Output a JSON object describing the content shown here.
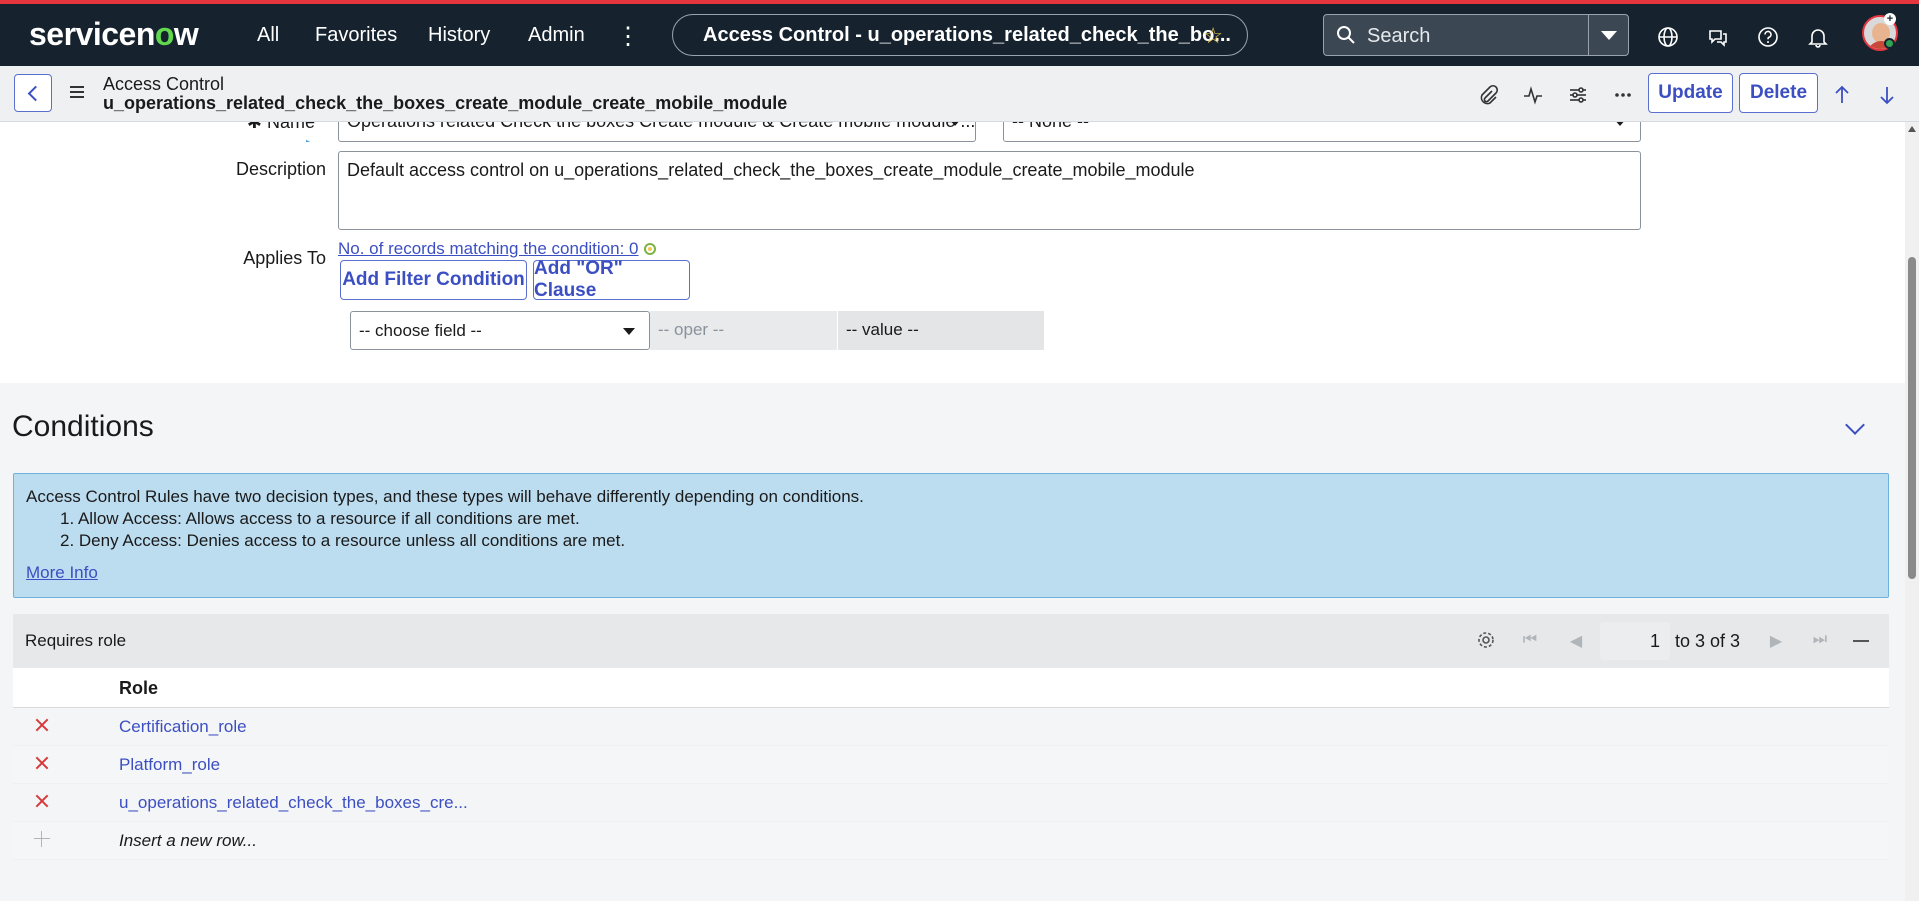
{
  "nav": {
    "logo_pre": "servicen",
    "logo_o": "o",
    "logo_post": "w",
    "links": [
      "All",
      "Favorites",
      "History",
      "Admin"
    ],
    "more": "⋮",
    "page_title": "Access Control - u_operations_related_check_the_bo...",
    "star": "☆",
    "search_placeholder": "Search"
  },
  "form_header": {
    "title": "Access Control",
    "subtitle": "u_operations_related_check_the_boxes_create_module_create_mobile_module",
    "update_label": "Update",
    "delete_label": "Delete"
  },
  "form": {
    "name_label": "Name",
    "name_value": "Operations related Check the boxes Create module & Create mobile module ...",
    "name_field2_value": "-- None --",
    "description_label": "Description",
    "description_value": "Default access control on u_operations_related_check_the_boxes_create_module_create_mobile_module",
    "applies_to_label": "Applies To",
    "records_link": "No. of records matching the condition: 0",
    "add_filter_label": "Add Filter Condition",
    "add_or_label": "Add \"OR\" Clause",
    "choose_field": "-- choose field --",
    "oper": "-- oper --",
    "value": "-- value --"
  },
  "conditions": {
    "title": "Conditions",
    "info_line1": "Access Control Rules have two decision types, and these types will behave differently depending on conditions.",
    "info_line2": "1. Allow Access: Allows access to a resource if all conditions are met.",
    "info_line3": "2. Deny Access: Denies access to a resource unless all conditions are met.",
    "more_info": "More Info"
  },
  "related_list": {
    "title": "Requires role",
    "page_current": "1",
    "page_text": "to 3 of 3",
    "column": "Role",
    "rows": [
      {
        "role": "Certification_role"
      },
      {
        "role": "Platform_role"
      },
      {
        "role": "u_operations_related_check_the_boxes_cre..."
      }
    ],
    "insert_row": "Insert a new row..."
  },
  "colors": {
    "nav_bg": "#16232f",
    "accent_red": "#e5363f",
    "link_blue": "#3c4fc2",
    "info_bg": "#bcdcf0"
  }
}
